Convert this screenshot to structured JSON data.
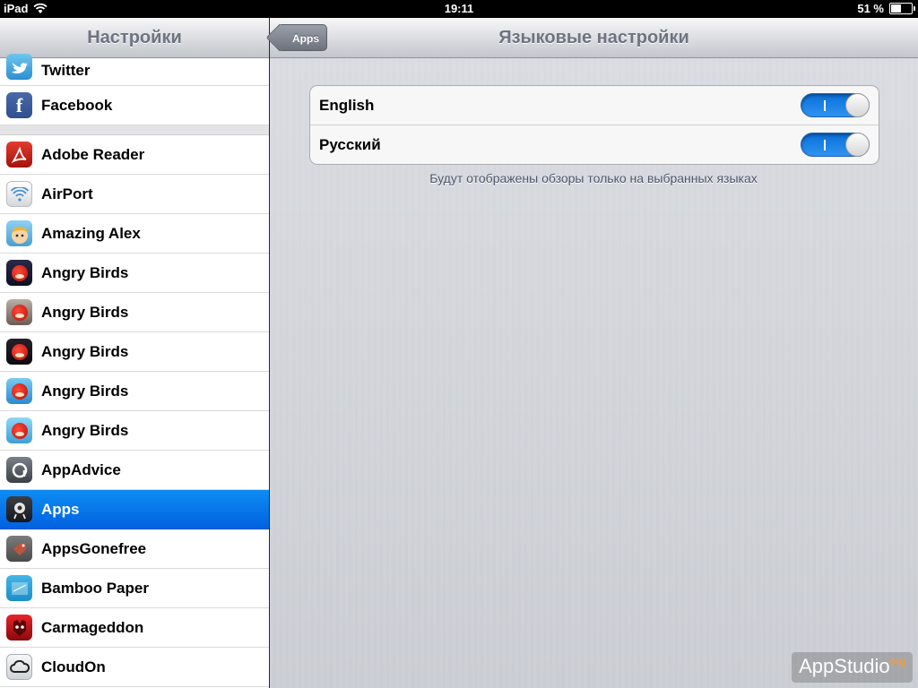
{
  "status_bar": {
    "device": "iPad",
    "time": "19:11",
    "battery": "51 %",
    "battery_level": 0.51
  },
  "sidebar": {
    "title": "Настройки",
    "items": [
      {
        "label": "Twitter",
        "icon": "twitter-icon"
      },
      {
        "label": "Facebook",
        "icon": "facebook-icon"
      },
      {
        "label": "Adobe Reader",
        "icon": "adobe-reader-icon"
      },
      {
        "label": "AirPort",
        "icon": "airport-icon"
      },
      {
        "label": "Amazing Alex",
        "icon": "amazing-alex-icon"
      },
      {
        "label": "Angry Birds",
        "icon": "angry-birds-space-icon"
      },
      {
        "label": "Angry Birds",
        "icon": "angry-birds-seasons-icon"
      },
      {
        "label": "Angry Birds",
        "icon": "angry-birds-star-wars-icon"
      },
      {
        "label": "Angry Birds",
        "icon": "angry-birds-hd-icon"
      },
      {
        "label": "Angry Birds",
        "icon": "angry-birds-rio-icon"
      },
      {
        "label": "AppAdvice",
        "icon": "appadvice-icon"
      },
      {
        "label": "Apps",
        "icon": "apps-icon",
        "selected": true
      },
      {
        "label": "AppsGonefree",
        "icon": "appsgonefree-icon"
      },
      {
        "label": "Bamboo Paper",
        "icon": "bamboo-paper-icon"
      },
      {
        "label": "Carmageddon",
        "icon": "carmageddon-icon"
      },
      {
        "label": "CloudOn",
        "icon": "cloudon-icon"
      }
    ]
  },
  "main": {
    "back_button": "Apps",
    "title": "Языковые настройки",
    "languages": [
      {
        "label": "English",
        "enabled": true,
        "toggle_glyph": "I"
      },
      {
        "label": "Русский",
        "enabled": true,
        "toggle_glyph": "I"
      }
    ],
    "footnote": "Будут отображены обзоры только на выбранных языках"
  },
  "watermark": {
    "text": "AppStudio",
    "suffix": "org"
  },
  "colors": {
    "selected_row": "#0d8cf3",
    "toggle_on": "#1a84ea",
    "navbar_text": "#6d7380",
    "footnote_text": "#4c566c"
  }
}
